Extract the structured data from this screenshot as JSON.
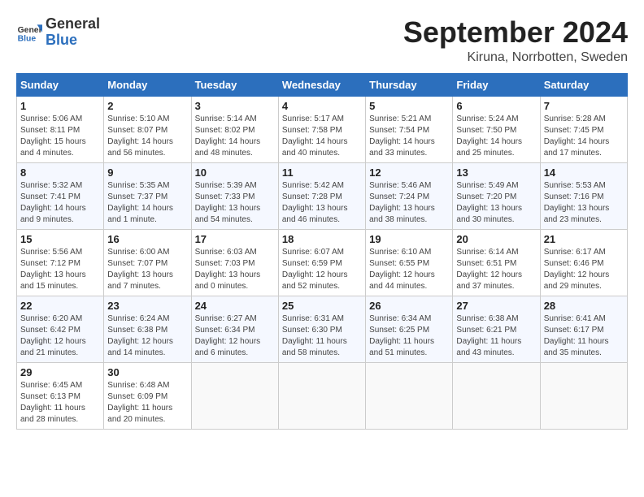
{
  "header": {
    "logo_general": "General",
    "logo_blue": "Blue",
    "month_title": "September 2024",
    "location": "Kiruna, Norrbotten, Sweden"
  },
  "days_of_week": [
    "Sunday",
    "Monday",
    "Tuesday",
    "Wednesday",
    "Thursday",
    "Friday",
    "Saturday"
  ],
  "weeks": [
    [
      {
        "day": "1",
        "sunrise": "Sunrise: 5:06 AM",
        "sunset": "Sunset: 8:11 PM",
        "daylight": "Daylight: 15 hours and 4 minutes."
      },
      {
        "day": "2",
        "sunrise": "Sunrise: 5:10 AM",
        "sunset": "Sunset: 8:07 PM",
        "daylight": "Daylight: 14 hours and 56 minutes."
      },
      {
        "day": "3",
        "sunrise": "Sunrise: 5:14 AM",
        "sunset": "Sunset: 8:02 PM",
        "daylight": "Daylight: 14 hours and 48 minutes."
      },
      {
        "day": "4",
        "sunrise": "Sunrise: 5:17 AM",
        "sunset": "Sunset: 7:58 PM",
        "daylight": "Daylight: 14 hours and 40 minutes."
      },
      {
        "day": "5",
        "sunrise": "Sunrise: 5:21 AM",
        "sunset": "Sunset: 7:54 PM",
        "daylight": "Daylight: 14 hours and 33 minutes."
      },
      {
        "day": "6",
        "sunrise": "Sunrise: 5:24 AM",
        "sunset": "Sunset: 7:50 PM",
        "daylight": "Daylight: 14 hours and 25 minutes."
      },
      {
        "day": "7",
        "sunrise": "Sunrise: 5:28 AM",
        "sunset": "Sunset: 7:45 PM",
        "daylight": "Daylight: 14 hours and 17 minutes."
      }
    ],
    [
      {
        "day": "8",
        "sunrise": "Sunrise: 5:32 AM",
        "sunset": "Sunset: 7:41 PM",
        "daylight": "Daylight: 14 hours and 9 minutes."
      },
      {
        "day": "9",
        "sunrise": "Sunrise: 5:35 AM",
        "sunset": "Sunset: 7:37 PM",
        "daylight": "Daylight: 14 hours and 1 minute."
      },
      {
        "day": "10",
        "sunrise": "Sunrise: 5:39 AM",
        "sunset": "Sunset: 7:33 PM",
        "daylight": "Daylight: 13 hours and 54 minutes."
      },
      {
        "day": "11",
        "sunrise": "Sunrise: 5:42 AM",
        "sunset": "Sunset: 7:28 PM",
        "daylight": "Daylight: 13 hours and 46 minutes."
      },
      {
        "day": "12",
        "sunrise": "Sunrise: 5:46 AM",
        "sunset": "Sunset: 7:24 PM",
        "daylight": "Daylight: 13 hours and 38 minutes."
      },
      {
        "day": "13",
        "sunrise": "Sunrise: 5:49 AM",
        "sunset": "Sunset: 7:20 PM",
        "daylight": "Daylight: 13 hours and 30 minutes."
      },
      {
        "day": "14",
        "sunrise": "Sunrise: 5:53 AM",
        "sunset": "Sunset: 7:16 PM",
        "daylight": "Daylight: 13 hours and 23 minutes."
      }
    ],
    [
      {
        "day": "15",
        "sunrise": "Sunrise: 5:56 AM",
        "sunset": "Sunset: 7:12 PM",
        "daylight": "Daylight: 13 hours and 15 minutes."
      },
      {
        "day": "16",
        "sunrise": "Sunrise: 6:00 AM",
        "sunset": "Sunset: 7:07 PM",
        "daylight": "Daylight: 13 hours and 7 minutes."
      },
      {
        "day": "17",
        "sunrise": "Sunrise: 6:03 AM",
        "sunset": "Sunset: 7:03 PM",
        "daylight": "Daylight: 13 hours and 0 minutes."
      },
      {
        "day": "18",
        "sunrise": "Sunrise: 6:07 AM",
        "sunset": "Sunset: 6:59 PM",
        "daylight": "Daylight: 12 hours and 52 minutes."
      },
      {
        "day": "19",
        "sunrise": "Sunrise: 6:10 AM",
        "sunset": "Sunset: 6:55 PM",
        "daylight": "Daylight: 12 hours and 44 minutes."
      },
      {
        "day": "20",
        "sunrise": "Sunrise: 6:14 AM",
        "sunset": "Sunset: 6:51 PM",
        "daylight": "Daylight: 12 hours and 37 minutes."
      },
      {
        "day": "21",
        "sunrise": "Sunrise: 6:17 AM",
        "sunset": "Sunset: 6:46 PM",
        "daylight": "Daylight: 12 hours and 29 minutes."
      }
    ],
    [
      {
        "day": "22",
        "sunrise": "Sunrise: 6:20 AM",
        "sunset": "Sunset: 6:42 PM",
        "daylight": "Daylight: 12 hours and 21 minutes."
      },
      {
        "day": "23",
        "sunrise": "Sunrise: 6:24 AM",
        "sunset": "Sunset: 6:38 PM",
        "daylight": "Daylight: 12 hours and 14 minutes."
      },
      {
        "day": "24",
        "sunrise": "Sunrise: 6:27 AM",
        "sunset": "Sunset: 6:34 PM",
        "daylight": "Daylight: 12 hours and 6 minutes."
      },
      {
        "day": "25",
        "sunrise": "Sunrise: 6:31 AM",
        "sunset": "Sunset: 6:30 PM",
        "daylight": "Daylight: 11 hours and 58 minutes."
      },
      {
        "day": "26",
        "sunrise": "Sunrise: 6:34 AM",
        "sunset": "Sunset: 6:25 PM",
        "daylight": "Daylight: 11 hours and 51 minutes."
      },
      {
        "day": "27",
        "sunrise": "Sunrise: 6:38 AM",
        "sunset": "Sunset: 6:21 PM",
        "daylight": "Daylight: 11 hours and 43 minutes."
      },
      {
        "day": "28",
        "sunrise": "Sunrise: 6:41 AM",
        "sunset": "Sunset: 6:17 PM",
        "daylight": "Daylight: 11 hours and 35 minutes."
      }
    ],
    [
      {
        "day": "29",
        "sunrise": "Sunrise: 6:45 AM",
        "sunset": "Sunset: 6:13 PM",
        "daylight": "Daylight: 11 hours and 28 minutes."
      },
      {
        "day": "30",
        "sunrise": "Sunrise: 6:48 AM",
        "sunset": "Sunset: 6:09 PM",
        "daylight": "Daylight: 11 hours and 20 minutes."
      },
      null,
      null,
      null,
      null,
      null
    ]
  ]
}
